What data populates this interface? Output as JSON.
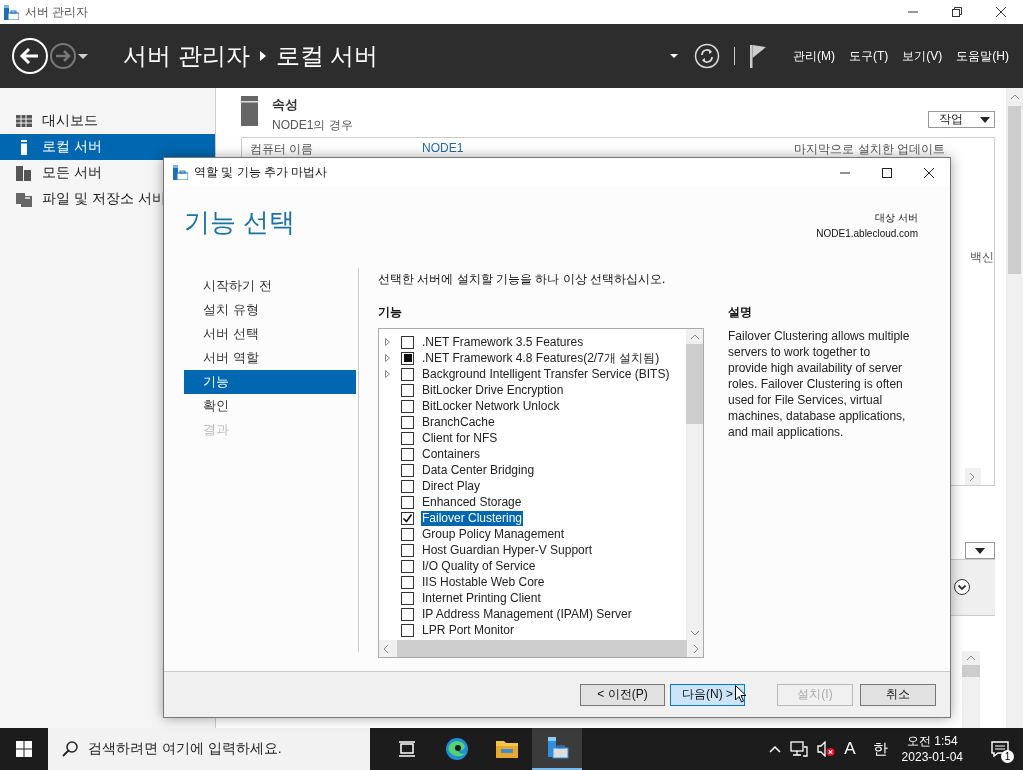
{
  "app": {
    "title": "서버 관리자",
    "breadcrumb": [
      "서버 관리자",
      "로컬 서버"
    ],
    "menus": [
      "관리(M)",
      "도구(T)",
      "보기(V)",
      "도움말(H)"
    ]
  },
  "sidebar": {
    "items": [
      {
        "label": "대시보드",
        "kind": "dashboard",
        "selected": false
      },
      {
        "label": "로컬 서버",
        "kind": "server",
        "selected": true
      },
      {
        "label": "모든 서버",
        "kind": "servers",
        "selected": false
      },
      {
        "label": "파일 및 저장소 서비",
        "kind": "files",
        "selected": false
      }
    ]
  },
  "properties": {
    "title": "속성",
    "subtitle": "NODE1의 경우",
    "tasks": "작업",
    "fields": [
      "컴퓨터 이름",
      "NODE1",
      "마지막으로 설치한 업데이트"
    ],
    "side_text": "백신"
  },
  "dialog": {
    "title": "역할 및 기능 추가 마법사",
    "heading": "기능 선택",
    "target_label": "대상 서버",
    "target_value": "NODE1.ablecloud.com",
    "steps": [
      {
        "label": "시작하기 전",
        "selected": false,
        "disabled": false
      },
      {
        "label": "설치 유형",
        "selected": false,
        "disabled": false
      },
      {
        "label": "서버 선택",
        "selected": false,
        "disabled": false
      },
      {
        "label": "서버 역할",
        "selected": false,
        "disabled": false
      },
      {
        "label": "기능",
        "selected": true,
        "disabled": false
      },
      {
        "label": "확인",
        "selected": false,
        "disabled": false
      },
      {
        "label": "결과",
        "selected": false,
        "disabled": true
      }
    ],
    "instruction": "선택한 서버에 설치할 기능을 하나 이상 선택하십시오.",
    "features_header": "기능",
    "features": [
      {
        "label": ".NET Framework 3.5 Features",
        "expandable": true,
        "checked": false,
        "indeterminate": false,
        "selected": false
      },
      {
        "label": ".NET Framework 4.8 Features(2/7개 설치됨)",
        "expandable": true,
        "checked": false,
        "indeterminate": true,
        "selected": false
      },
      {
        "label": "Background Intelligent Transfer Service (BITS)",
        "expandable": true,
        "checked": false,
        "indeterminate": false,
        "selected": false
      },
      {
        "label": "BitLocker Drive Encryption",
        "expandable": false,
        "checked": false,
        "indeterminate": false,
        "selected": false
      },
      {
        "label": "BitLocker Network Unlock",
        "expandable": false,
        "checked": false,
        "indeterminate": false,
        "selected": false
      },
      {
        "label": "BranchCache",
        "expandable": false,
        "checked": false,
        "indeterminate": false,
        "selected": false
      },
      {
        "label": "Client for NFS",
        "expandable": false,
        "checked": false,
        "indeterminate": false,
        "selected": false
      },
      {
        "label": "Containers",
        "expandable": false,
        "checked": false,
        "indeterminate": false,
        "selected": false
      },
      {
        "label": "Data Center Bridging",
        "expandable": false,
        "checked": false,
        "indeterminate": false,
        "selected": false
      },
      {
        "label": "Direct Play",
        "expandable": false,
        "checked": false,
        "indeterminate": false,
        "selected": false
      },
      {
        "label": "Enhanced Storage",
        "expandable": false,
        "checked": false,
        "indeterminate": false,
        "selected": false
      },
      {
        "label": "Failover Clustering",
        "expandable": false,
        "checked": true,
        "indeterminate": false,
        "selected": true
      },
      {
        "label": "Group Policy Management",
        "expandable": false,
        "checked": false,
        "indeterminate": false,
        "selected": false
      },
      {
        "label": "Host Guardian Hyper-V Support",
        "expandable": false,
        "checked": false,
        "indeterminate": false,
        "selected": false
      },
      {
        "label": "I/O Quality of Service",
        "expandable": false,
        "checked": false,
        "indeterminate": false,
        "selected": false
      },
      {
        "label": "IIS Hostable Web Core",
        "expandable": false,
        "checked": false,
        "indeterminate": false,
        "selected": false
      },
      {
        "label": "Internet Printing Client",
        "expandable": false,
        "checked": false,
        "indeterminate": false,
        "selected": false
      },
      {
        "label": "IP Address Management (IPAM) Server",
        "expandable": false,
        "checked": false,
        "indeterminate": false,
        "selected": false
      },
      {
        "label": "LPR Port Monitor",
        "expandable": false,
        "checked": false,
        "indeterminate": false,
        "selected": false
      }
    ],
    "description_header": "설명",
    "description": "Failover Clustering allows multiple servers to work together to provide high availability of server roles. Failover Clustering is often used for File Services, virtual machines, database applications, and mail applications.",
    "buttons": [
      {
        "label": "< 이전(P)",
        "kind": "normal"
      },
      {
        "label": "다음(N) >",
        "kind": "default"
      },
      {
        "label": "설치(I)",
        "kind": "disabled"
      },
      {
        "label": "취소",
        "kind": "normal"
      }
    ]
  },
  "taskbar": {
    "search_placeholder": "검색하려면 여기에 입력하세요.",
    "input_mode": "A",
    "ime": "한",
    "time": "오전 1:54",
    "date": "2023-01-04",
    "notifications": "1"
  }
}
